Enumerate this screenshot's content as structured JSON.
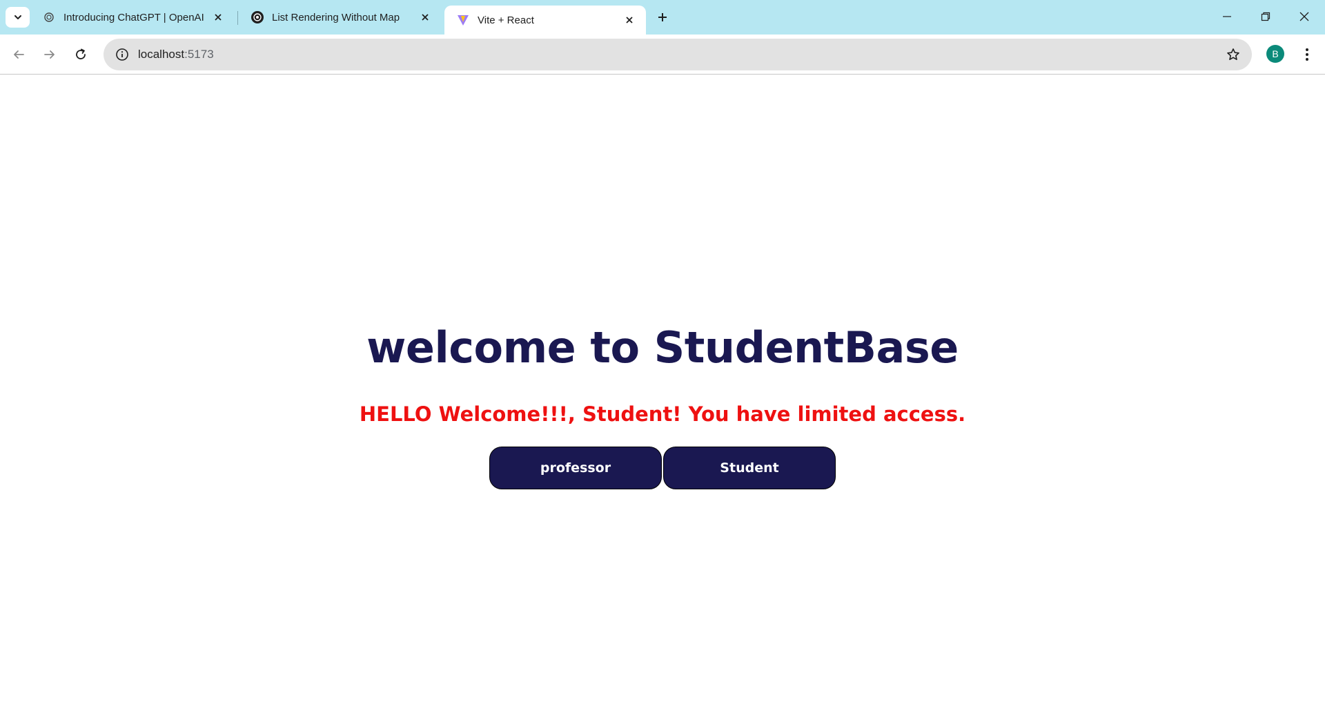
{
  "browser": {
    "tabs": [
      {
        "title": "Introducing ChatGPT | OpenAI",
        "favicon": "openai-logo-icon",
        "active": false
      },
      {
        "title": "List Rendering Without Map",
        "favicon": "chatgpt-logo-icon",
        "active": false
      },
      {
        "title": "Vite + React",
        "favicon": "vite-logo-icon",
        "active": true
      }
    ],
    "address": {
      "host": "localhost",
      "port": ":5173"
    },
    "profile_initial": "B"
  },
  "page": {
    "heading": "welcome to StudentBase",
    "message": "HELLO Welcome!!!, Student! You have limited access.",
    "buttons": {
      "professor": "professor",
      "student": "Student"
    }
  },
  "colors": {
    "tabstrip": "#b6e7f2",
    "heading": "#1a1851",
    "message": "#ee1111",
    "button_bg": "#1a1851",
    "avatar": "#0b8a7a"
  }
}
